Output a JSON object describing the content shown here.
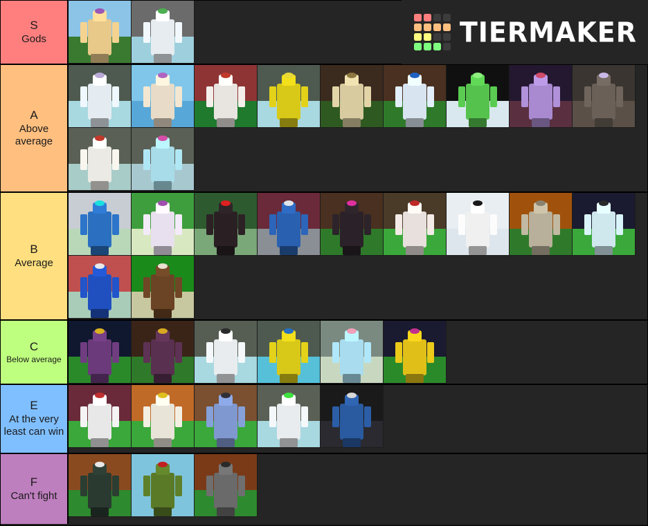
{
  "app": {
    "name": "TierMaker",
    "logo_text": "TIERMAKER",
    "background_color": "#1f1f1f",
    "row_background_color": "#252525"
  },
  "logo_grid_colors": [
    "#FF7F7F",
    "#FF7F7F",
    "#3c3c3c",
    "#3c3c3c",
    "#FFBF7F",
    "#FFBF7F",
    "#FFBF7F",
    "#FFBF7F",
    "#FFFF7F",
    "#FFFF7F",
    "#3c3c3c",
    "#3c3c3c",
    "#7FFF7F",
    "#7FFF7F",
    "#7FFF7F",
    "#3c3c3c"
  ],
  "tiers": [
    {
      "letter": "S",
      "subtitle": "Gods",
      "color": "#FF7F7F",
      "height": 93,
      "small_subtitle": false,
      "items": [
        {
          "name": "character-cake-man",
          "sky": "#8cc4e8",
          "ground": "#3a7a30",
          "body": "#e8c98a",
          "accent": "#9b59b6"
        },
        {
          "name": "character-green-hair-spotted",
          "sky": "#6b6b6b",
          "ground": "#9ecfdd",
          "body": "#e6ecef",
          "accent": "#4caf50"
        }
      ]
    },
    {
      "letter": "A",
      "subtitle": "Above average",
      "color": "#FFBF7F",
      "height": 185,
      "small_subtitle": false,
      "items": [
        {
          "name": "character-white-armor",
          "sky": "#4e5a50",
          "ground": "#a8d8e0",
          "body": "#e4ecf2",
          "accent": "#b9a9d6"
        },
        {
          "name": "character-ocean-sunset",
          "sky": "#7fc6ea",
          "ground": "#57a8d8",
          "body": "#e8dcc8",
          "accent": "#b065c0"
        },
        {
          "name": "character-red-striped",
          "sky": "#8e3434",
          "ground": "#1f7a2e",
          "body": "#e8e4e0",
          "accent": "#c0392b"
        },
        {
          "name": "character-gold-figure",
          "sky": "#4e5a50",
          "ground": "#a8d8e0",
          "body": "#d8c818",
          "accent": "#e8d838"
        },
        {
          "name": "character-beige-forest",
          "sky": "#3b2a1e",
          "ground": "#2e5a22",
          "body": "#d8cba0",
          "accent": "#8d7740"
        },
        {
          "name": "character-blue-knight",
          "sky": "#4a3020",
          "ground": "#2e7a2a",
          "body": "#d8e4ef",
          "accent": "#2060c0"
        },
        {
          "name": "character-green-glow",
          "sky": "#101010",
          "ground": "#d8e8ee",
          "body": "#56c24e",
          "accent": "#8ef07e"
        },
        {
          "name": "character-purple-demon",
          "sky": "#241830",
          "ground": "#5a3040",
          "body": "#a98ad0",
          "accent": "#d04a6a"
        },
        {
          "name": "character-dark-shadow",
          "sky": "#3a3530",
          "ground": "#5a5048",
          "body": "#6a6058",
          "accent": "#c8b8e8"
        },
        {
          "name": "character-white-golden",
          "sky": "#5a6055",
          "ground": "#a8ccc8",
          "body": "#eceae4",
          "accent": "#c0392b"
        },
        {
          "name": "character-rabbit-blue",
          "sky": "#5a6055",
          "ground": "#a8c8d0",
          "body": "#a8dce8",
          "accent": "#d44fa8"
        }
      ]
    },
    {
      "letter": "B",
      "subtitle": "Average",
      "color": "#FFDF7F",
      "height": 185,
      "small_subtitle": false,
      "items": [
        {
          "name": "character-blue-hoodie-neon",
          "sky": "#c8cdd4",
          "ground": "#b8d8b8",
          "body": "#2a6fc0",
          "accent": "#18e0e0"
        },
        {
          "name": "character-purple-checker",
          "sky": "#3e9e3e",
          "ground": "#d8e8c0",
          "body": "#e8e0ee",
          "accent": "#a050b0"
        },
        {
          "name": "character-dark-red-eyes",
          "sky": "#2e5a30",
          "ground": "#7aa878",
          "body": "#2a2024",
          "accent": "#e02020"
        },
        {
          "name": "character-blue-shirt-gray",
          "sky": "#6a2a3a",
          "ground": "#8a8f95",
          "body": "#2a60b0",
          "accent": "#dfe5ea"
        },
        {
          "name": "character-dark-neon-hair",
          "sky": "#4a3020",
          "ground": "#2e7a2a",
          "body": "#2a2228",
          "accent": "#e030a0"
        },
        {
          "name": "character-red-white-knight",
          "sky": "#4a3a28",
          "ground": "#3aa83a",
          "body": "#e8e0dc",
          "accent": "#c02828"
        },
        {
          "name": "character-black-white-suit",
          "sky": "#e8eef2",
          "ground": "#dde6ec",
          "body": "#f0f0f0",
          "accent": "#1a1a1a"
        },
        {
          "name": "character-stone-robot",
          "sky": "#a0520c",
          "ground": "#2e7a2a",
          "body": "#b8b09a",
          "accent": "#8a8270"
        },
        {
          "name": "character-night-tree",
          "sky": "#1a1a30",
          "ground": "#3aa83a",
          "body": "#cfe8ee",
          "accent": "#2a2a2a"
        },
        {
          "name": "character-blue-mech",
          "sky": "#c05050",
          "ground": "#a8ccb8",
          "body": "#2050c0",
          "accent": "#e8e8e8"
        },
        {
          "name": "character-brown-vest",
          "sky": "#1a8a1a",
          "ground": "#c8c8a0",
          "body": "#6a4424",
          "accent": "#e8e0d0"
        }
      ]
    },
    {
      "letter": "C",
      "subtitle": "Below average",
      "color": "#BFFF7F",
      "height": 93,
      "small_subtitle": true,
      "items": [
        {
          "name": "character-purple-gold-night",
          "sky": "#101830",
          "ground": "#2a8a2a",
          "body": "#6a3a7a",
          "accent": "#d8b020"
        },
        {
          "name": "character-canyon-small",
          "sky": "#3a2418",
          "ground": "#2e7a2a",
          "body": "#5a3050",
          "accent": "#d8a820"
        },
        {
          "name": "character-white-cat-helm",
          "sky": "#565e54",
          "ground": "#a8d8e0",
          "body": "#e8ecee",
          "accent": "#2a2a2a"
        },
        {
          "name": "character-yellow-blue-trim",
          "sky": "#4e5a50",
          "ground": "#56c0d8",
          "body": "#d8c818",
          "accent": "#2a70c0"
        },
        {
          "name": "character-pink-blue-robot",
          "sky": "#7a8a80",
          "ground": "#c8d8c0",
          "body": "#a8dcee",
          "accent": "#f0a0b8"
        },
        {
          "name": "character-gold-sunset-tree",
          "sky": "#1a1a30",
          "ground": "#2a8a2a",
          "body": "#e0c018",
          "accent": "#c0308a"
        }
      ]
    },
    {
      "letter": "E",
      "subtitle": "At the very least can win",
      "color": "#7FBFFF",
      "height": 100,
      "small_subtitle": false,
      "items": [
        {
          "name": "item-white-red-weapon",
          "sky": "#6a2a3a",
          "ground": "#3aa83a",
          "body": "#e8e8e8",
          "accent": "#c03030"
        },
        {
          "name": "item-sword-pillar",
          "sky": "#c06a28",
          "ground": "#3aa83a",
          "body": "#e8e4d8",
          "accent": "#e0c020"
        },
        {
          "name": "item-blue-pistol",
          "sky": "#7a5030",
          "ground": "#3aa83a",
          "body": "#8098d0",
          "accent": "#303038"
        },
        {
          "name": "character-green-glow-small",
          "sky": "#5a6055",
          "ground": "#a8d8e0",
          "body": "#e8ecee",
          "accent": "#40e040"
        },
        {
          "name": "character-blue-shirt-indoor",
          "sky": "#1a1a1a",
          "ground": "#2a2a30",
          "body": "#2a5aa0",
          "accent": "#d8d8d8"
        }
      ]
    },
    {
      "letter": "F",
      "subtitle": "Can't fight",
      "color": "#BE7FBE",
      "height": 101,
      "small_subtitle": false,
      "items": [
        {
          "name": "character-dark-robe",
          "sky": "#8a4a20",
          "ground": "#2e8a2e",
          "body": "#2a3a30",
          "accent": "#e8e8e8"
        },
        {
          "name": "item-green-fruit",
          "sky": "#7fc4dd",
          "ground": "#7fc4dd",
          "body": "#5a7a28",
          "accent": "#c02020"
        },
        {
          "name": "character-antler-gray",
          "sky": "#7a3a18",
          "ground": "#2e8a2e",
          "body": "#6a6a6a",
          "accent": "#2a2a2a"
        }
      ]
    }
  ]
}
